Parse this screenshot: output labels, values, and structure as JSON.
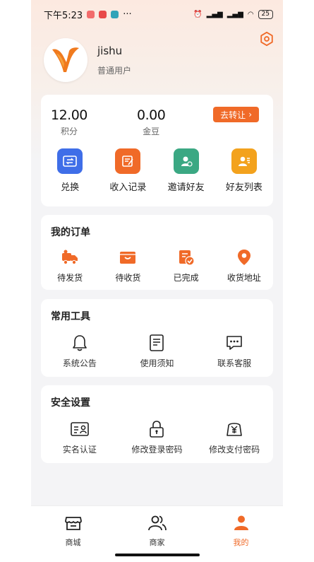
{
  "status": {
    "time": "下午5:23",
    "dots": "···",
    "battery": "25"
  },
  "profile": {
    "name": "jishu",
    "role": "普通用户"
  },
  "wallet": {
    "points_value": "12.00",
    "points_label": "积分",
    "gold_value": "0.00",
    "gold_label": "金豆",
    "transfer_label": "去转让",
    "actions": [
      {
        "label": "兑换",
        "icon": "exchange-icon",
        "color": "#3f6ee8"
      },
      {
        "label": "收入记录",
        "icon": "income-record-icon",
        "color": "#f06a28"
      },
      {
        "label": "邀请好友",
        "icon": "invite-friend-icon",
        "color": "#3ba883"
      },
      {
        "label": "好友列表",
        "icon": "friend-list-icon",
        "color": "#f3a21d"
      }
    ]
  },
  "orders": {
    "title": "我的订单",
    "items": [
      {
        "label": "待发货",
        "icon": "truck-icon"
      },
      {
        "label": "待收货",
        "icon": "box-icon"
      },
      {
        "label": "已完成",
        "icon": "completed-icon"
      },
      {
        "label": "收货地址",
        "icon": "location-icon"
      }
    ]
  },
  "tools": {
    "title": "常用工具",
    "items": [
      {
        "label": "系统公告",
        "icon": "bell-icon"
      },
      {
        "label": "使用须知",
        "icon": "document-icon"
      },
      {
        "label": "联系客服",
        "icon": "chat-icon"
      }
    ]
  },
  "security": {
    "title": "安全设置",
    "items": [
      {
        "label": "实名认证",
        "icon": "id-card-icon"
      },
      {
        "label": "修改登录密码",
        "icon": "lock-icon"
      },
      {
        "label": "修改支付密码",
        "icon": "yen-wallet-icon"
      }
    ]
  },
  "tabbar": {
    "tabs": [
      {
        "label": "商城",
        "icon": "shop-icon",
        "active": false
      },
      {
        "label": "商家",
        "icon": "merchants-icon",
        "active": false
      },
      {
        "label": "我的",
        "icon": "me-icon",
        "active": true
      }
    ]
  },
  "colors": {
    "accent": "#f06a28",
    "brand_orange": "#f07a1e"
  }
}
